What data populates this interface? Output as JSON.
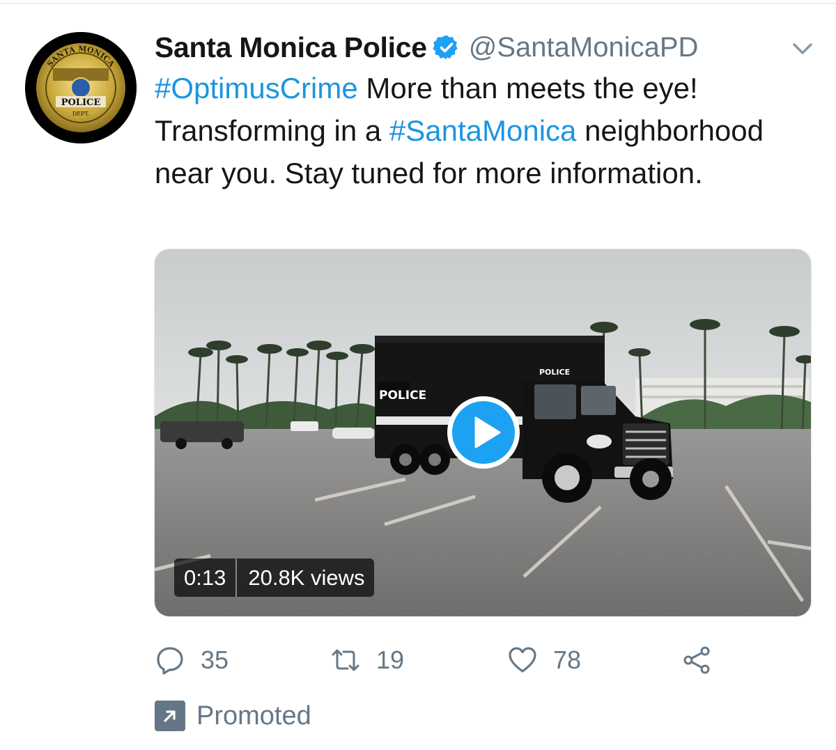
{
  "tweet": {
    "display_name": "Santa Monica Police",
    "handle": "@SantaMonicaPD",
    "verified": true,
    "text_segments": [
      {
        "text": "#OptimusCrime",
        "type": "hashtag"
      },
      {
        "text": " More than meets the eye! Transforming in a ",
        "type": "text"
      },
      {
        "text": "#SantaMonica",
        "type": "hashtag"
      },
      {
        "text": " neighborhood near you. Stay tuned for more information.",
        "type": "text"
      }
    ],
    "avatar": {
      "top_text": "SANTA MONICA",
      "center_text": "POLICE",
      "bottom_text": "DEPT."
    }
  },
  "video": {
    "duration": "0:13",
    "views": "20.8K views",
    "truck_side_label": "POLICE",
    "truck_roof_label": "POLICE"
  },
  "actions": {
    "reply_count": "35",
    "retweet_count": "19",
    "like_count": "78"
  },
  "promoted_label": "Promoted",
  "colors": {
    "link": "#1b95e0",
    "text": "#14171a",
    "secondary": "#657786",
    "verified": "#1da1f2"
  },
  "icons": [
    "verified-badge-icon",
    "chevron-down-icon",
    "play-icon",
    "reply-icon",
    "retweet-icon",
    "heart-icon",
    "share-icon",
    "promoted-arrow-icon"
  ]
}
